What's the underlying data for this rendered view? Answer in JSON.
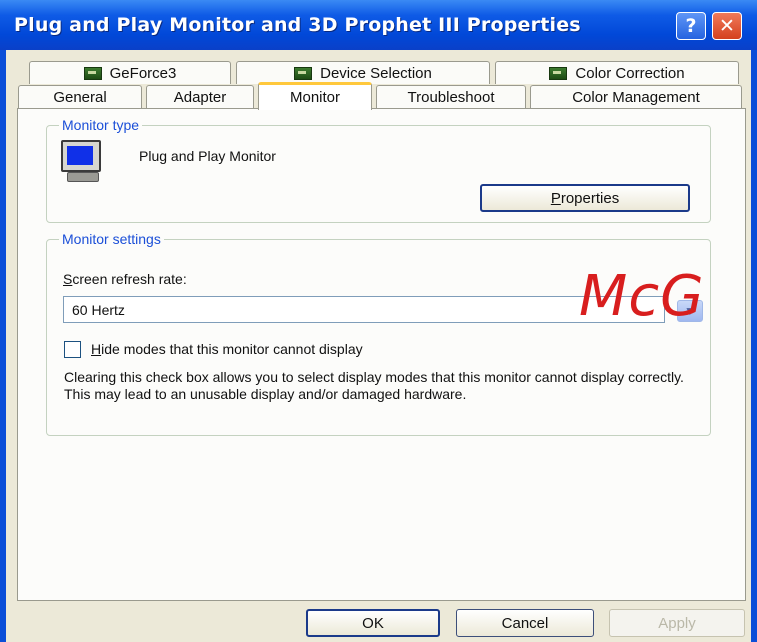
{
  "window": {
    "title": "Plug and Play Monitor and 3D Prophet III Properties",
    "help_glyph": "?",
    "close_glyph": "✕"
  },
  "tabs": {
    "row_top": [
      {
        "label": "GeForce3",
        "icon": "nvidia-icon"
      },
      {
        "label": "Device Selection",
        "icon": "nvidia-icon"
      },
      {
        "label": "Color Correction",
        "icon": "nvidia-icon"
      }
    ],
    "row_bottom": [
      {
        "label": "General"
      },
      {
        "label": "Adapter"
      },
      {
        "label": "Monitor",
        "active": true
      },
      {
        "label": "Troubleshoot"
      },
      {
        "label": "Color Management"
      }
    ]
  },
  "monitor_type": {
    "group_label": "Monitor type",
    "monitor_name": "Plug and Play Monitor",
    "properties_prefix": "",
    "properties_accel": "P",
    "properties_suffix": "roperties"
  },
  "monitor_settings": {
    "group_label": "Monitor settings",
    "refresh_accel": "S",
    "refresh_suffix": "creen refresh rate:",
    "refresh_value": "60 Hertz",
    "hide_modes_accel": "H",
    "hide_modes_suffix": "ide modes that this monitor cannot display",
    "hide_modes_checked": false,
    "note": "Clearing this check box allows you to select display modes that this monitor cannot display correctly. This may lead to an unusable display and/or damaged hardware."
  },
  "footer": {
    "ok": "OK",
    "cancel": "Cancel",
    "apply": "Apply"
  },
  "watermark": "McG",
  "colors": {
    "titlebar": "#0148d8",
    "group_label": "#1b4fd8",
    "active_tab_accent": "#ffc83c",
    "watermark": "#d81e1e"
  }
}
